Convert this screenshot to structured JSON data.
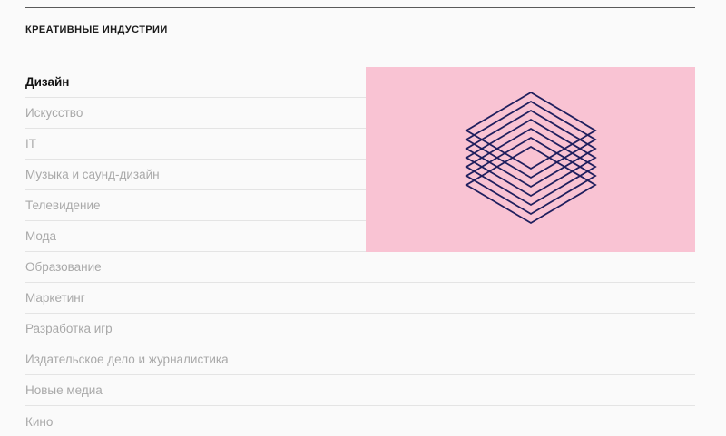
{
  "section": {
    "title": "КРЕАТИВНЫЕ ИНДУСТРИИ"
  },
  "menu": {
    "items": [
      {
        "label": "Дизайн",
        "active": true
      },
      {
        "label": "Искусство",
        "active": false
      },
      {
        "label": "IT",
        "active": false
      },
      {
        "label": "Музыка и саунд-дизайн",
        "active": false
      },
      {
        "label": "Телевидение",
        "active": false
      },
      {
        "label": "Мода",
        "active": false
      },
      {
        "label": "Образование",
        "active": false
      },
      {
        "label": "Маркетинг",
        "active": false
      },
      {
        "label": "Разработка игр",
        "active": false
      },
      {
        "label": "Издательское дело и журналистика",
        "active": false
      },
      {
        "label": "Новые медиа",
        "active": false
      },
      {
        "label": "Кино",
        "active": false
      }
    ]
  },
  "preview": {
    "icon": "stacked-diamonds-icon",
    "background_color": "#f9c3d3",
    "stroke_color": "#1f1f5e"
  },
  "colors": {
    "active_text": "#111111",
    "inactive_text": "#a9a9a9"
  }
}
